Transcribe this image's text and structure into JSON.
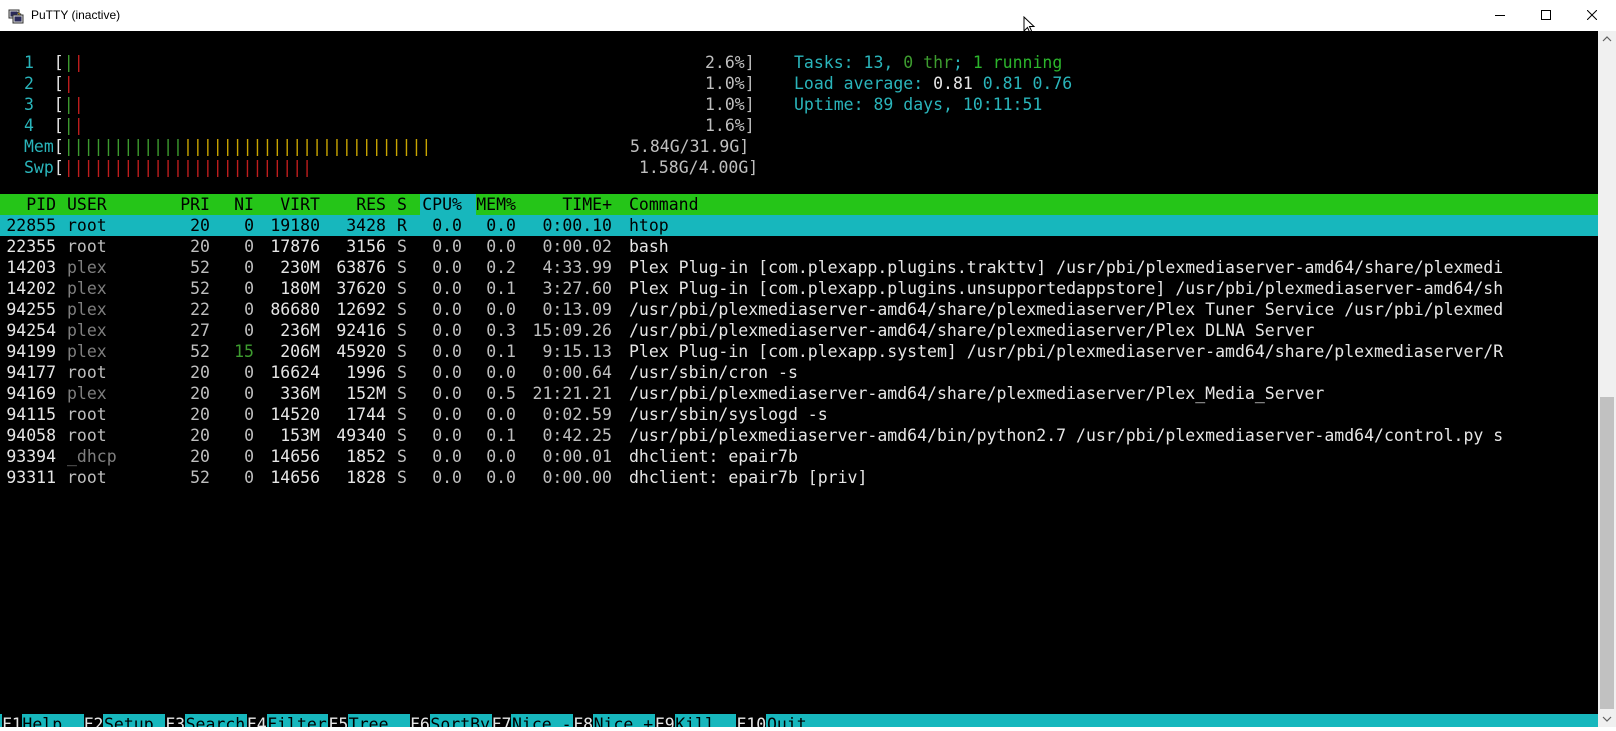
{
  "window": {
    "title": "PuTTY (inactive)"
  },
  "meters": {
    "cpus": [
      {
        "num": "1",
        "value": "2.6%]"
      },
      {
        "num": "2",
        "value": "1.0%]"
      },
      {
        "num": "3",
        "value": "1.0%]"
      },
      {
        "num": "4",
        "value": "1.6%]"
      }
    ],
    "mem": {
      "label": "Mem",
      "value": "5.84G/31.9G]"
    },
    "swp": {
      "label": "Swp",
      "value": "1.58G/4.00G]"
    }
  },
  "stats": {
    "tasks_label": "Tasks: ",
    "tasks_count": "13",
    "tasks_sep": ", ",
    "threads_count": "0",
    "threads_label": " thr",
    "running_sep": "; ",
    "running_count": "1",
    "running_label": " running",
    "load_label": "Load average: ",
    "load_1": "0.81",
    "load_5": "0.81",
    "load_15": "0.76",
    "uptime_label": "Uptime: ",
    "uptime_value": "89 days, 10:11:51"
  },
  "table": {
    "headers": {
      "pid": "  PID",
      "user": "USER",
      "pri": "PRI",
      "ni": "NI",
      "virt": "VIRT",
      "res": "RES",
      "s": "S",
      "cpu": "CPU%",
      "mem": "MEM%",
      "time": "TIME+",
      "cmd": "Command"
    },
    "rows": [
      {
        "pid": "22855",
        "user": "root",
        "pri": "20",
        "ni": "0",
        "virt": "19180",
        "res": "3428",
        "s": "R",
        "cpu": "0.0",
        "mem": "0.0",
        "time": "0:00.10",
        "cmd": "htop"
      },
      {
        "pid": "22355",
        "user": "root",
        "pri": "20",
        "ni": "0",
        "virt": "17876",
        "res": "3156",
        "s": "S",
        "cpu": "0.0",
        "mem": "0.0",
        "time": "0:00.02",
        "cmd": "bash"
      },
      {
        "pid": "14203",
        "user": "plex",
        "pri": "52",
        "ni": "0",
        "virt": "230M",
        "res": "63876",
        "s": "S",
        "cpu": "0.0",
        "mem": "0.2",
        "time": "4:33.99",
        "cmd": "Plex Plug-in [com.plexapp.plugins.trakttv] /usr/pbi/plexmediaserver-amd64/share/plexmedi"
      },
      {
        "pid": "14202",
        "user": "plex",
        "pri": "52",
        "ni": "0",
        "virt": "180M",
        "res": "37620",
        "s": "S",
        "cpu": "0.0",
        "mem": "0.1",
        "time": "3:27.60",
        "cmd": "Plex Plug-in [com.plexapp.plugins.unsupportedappstore] /usr/pbi/plexmediaserver-amd64/sh"
      },
      {
        "pid": "94255",
        "user": "plex",
        "pri": "22",
        "ni": "0",
        "virt": "86680",
        "res": "12692",
        "s": "S",
        "cpu": "0.0",
        "mem": "0.0",
        "time": "0:13.09",
        "cmd": "/usr/pbi/plexmediaserver-amd64/share/plexmediaserver/Plex Tuner Service /usr/pbi/plexmed"
      },
      {
        "pid": "94254",
        "user": "plex",
        "pri": "27",
        "ni": "0",
        "virt": "236M",
        "res": "92416",
        "s": "S",
        "cpu": "0.0",
        "mem": "0.3",
        "time": "15:09.26",
        "cmd": "/usr/pbi/plexmediaserver-amd64/share/plexmediaserver/Plex DLNA Server"
      },
      {
        "pid": "94199",
        "user": "plex",
        "pri": "52",
        "ni": "15",
        "virt": "206M",
        "res": "45920",
        "s": "S",
        "cpu": "0.0",
        "mem": "0.1",
        "time": "9:15.13",
        "cmd": "Plex Plug-in [com.plexapp.system] /usr/pbi/plexmediaserver-amd64/share/plexmediaserver/R"
      },
      {
        "pid": "94177",
        "user": "root",
        "pri": "20",
        "ni": "0",
        "virt": "16624",
        "res": "1996",
        "s": "S",
        "cpu": "0.0",
        "mem": "0.0",
        "time": "0:00.64",
        "cmd": "/usr/sbin/cron -s"
      },
      {
        "pid": "94169",
        "user": "plex",
        "pri": "20",
        "ni": "0",
        "virt": "336M",
        "res": "152M",
        "s": "S",
        "cpu": "0.0",
        "mem": "0.5",
        "time": "21:21.21",
        "cmd": "/usr/pbi/plexmediaserver-amd64/share/plexmediaserver/Plex_Media_Server"
      },
      {
        "pid": "94115",
        "user": "root",
        "pri": "20",
        "ni": "0",
        "virt": "14520",
        "res": "1744",
        "s": "S",
        "cpu": "0.0",
        "mem": "0.0",
        "time": "0:02.59",
        "cmd": "/usr/sbin/syslogd -s"
      },
      {
        "pid": "94058",
        "user": "root",
        "pri": "20",
        "ni": "0",
        "virt": "153M",
        "res": "49340",
        "s": "S",
        "cpu": "0.0",
        "mem": "0.1",
        "time": "0:42.25",
        "cmd": "/usr/pbi/plexmediaserver-amd64/bin/python2.7 /usr/pbi/plexmediaserver-amd64/control.py s"
      },
      {
        "pid": "93394",
        "user": "_dhcp",
        "pri": "20",
        "ni": "0",
        "virt": "14656",
        "res": "1852",
        "s": "S",
        "cpu": "0.0",
        "mem": "0.0",
        "time": "0:00.01",
        "cmd": "dhclient: epair7b"
      },
      {
        "pid": "93311",
        "user": "root",
        "pri": "52",
        "ni": "0",
        "virt": "14656",
        "res": "1828",
        "s": "S",
        "cpu": "0.0",
        "mem": "0.0",
        "time": "0:00.00",
        "cmd": "dhclient: epair7b [priv]"
      }
    ]
  },
  "footer": [
    {
      "key": "F1",
      "label": "Help  "
    },
    {
      "key": "F2",
      "label": "Setup "
    },
    {
      "key": "F3",
      "label": "Search"
    },
    {
      "key": "F4",
      "label": "Filter"
    },
    {
      "key": "F5",
      "label": "Tree  "
    },
    {
      "key": "F6",
      "label": "SortBy"
    },
    {
      "key": "F7",
      "label": "Nice -"
    },
    {
      "key": "F8",
      "label": "Nice +"
    },
    {
      "key": "F9",
      "label": "Kill  "
    },
    {
      "key": "F10",
      "label": "Quit"
    }
  ],
  "colors": {
    "header_bg": "#25c518",
    "selected_bg": "#17b7bd",
    "terminal_bg": "#000000",
    "accent_cyan": "#2ab5bb"
  }
}
